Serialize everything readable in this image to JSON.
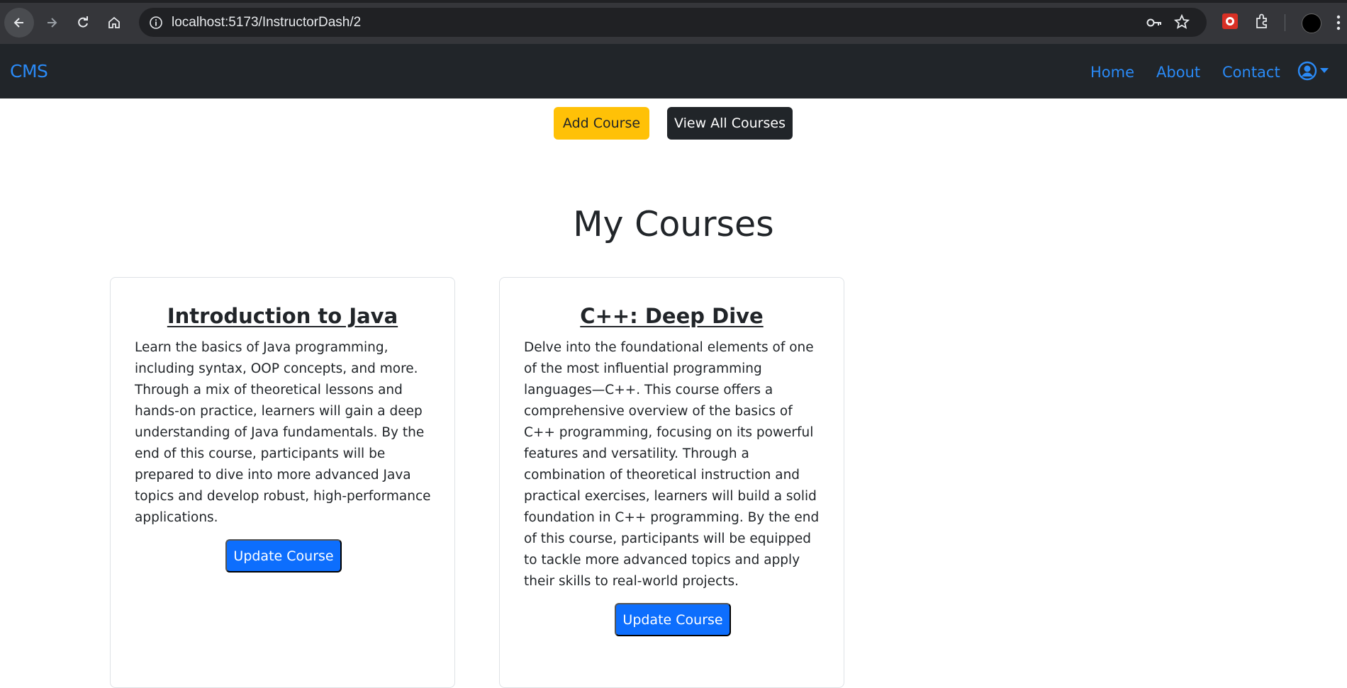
{
  "browser": {
    "url": "localhost:5173/InstructorDash/2"
  },
  "navbar": {
    "brand": "CMS",
    "links": [
      "Home",
      "About",
      "Contact"
    ]
  },
  "actions": {
    "add_course": "Add Course",
    "view_all": "View All Courses"
  },
  "page": {
    "title": "My Courses"
  },
  "courses": [
    {
      "title": "Introduction to Java",
      "description": "Learn the basics of Java programming, including syntax, OOP concepts, and more. Through a mix of theoretical lessons and hands-on practice, learners will gain a deep understanding of Java fundamentals. By the end of this course, participants will be prepared to dive into more advanced Java topics and develop robust, high-performance applications.",
      "button": "Update Course"
    },
    {
      "title": "C++: Deep Dive",
      "description": "Delve into the foundational elements of one of the most influential programming languages—C++. This course offers a comprehensive overview of the basics of C++ programming, focusing on its powerful features and versatility. Through a combination of theoretical instruction and practical exercises, learners will build a solid foundation in C++ programming. By the end of this course, participants will be equipped to tackle more advanced topics and apply their skills to real-world projects.",
      "button": "Update Course"
    }
  ],
  "colors": {
    "navbar_bg": "#212529",
    "link": "#2a8af6",
    "warning": "#ffc107",
    "primary": "#0d6efd"
  }
}
